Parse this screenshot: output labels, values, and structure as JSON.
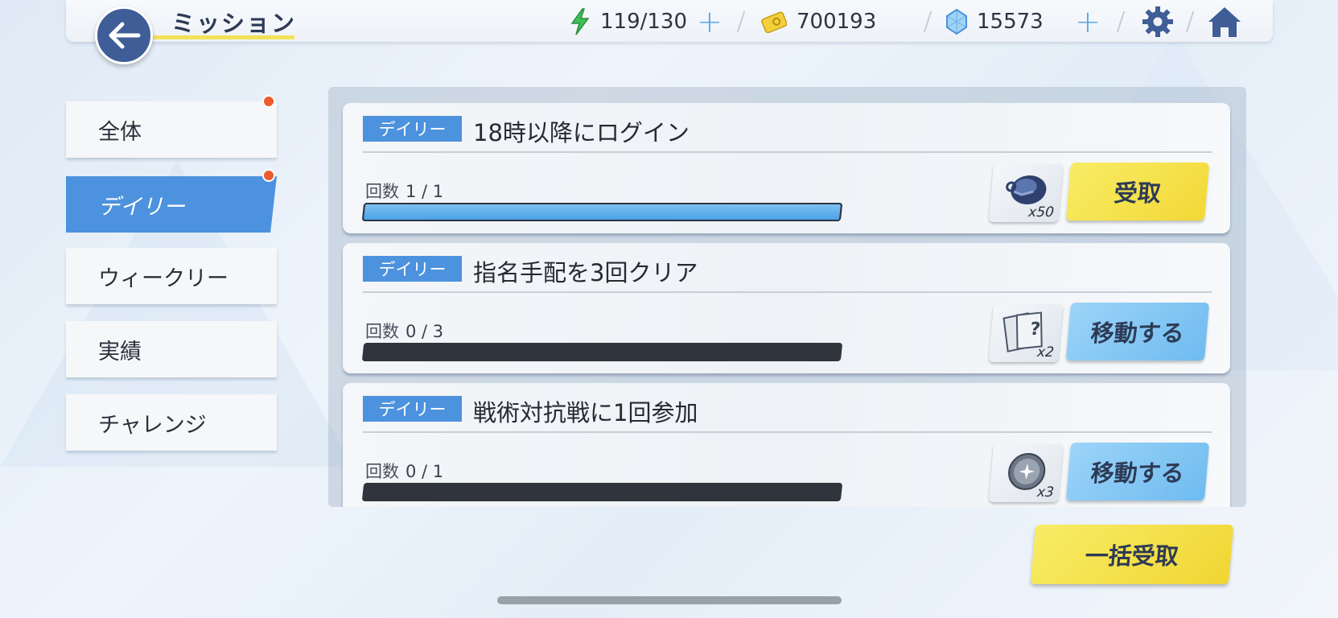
{
  "header": {
    "title": "ミッション",
    "stamina": "119/130",
    "coins": "700193",
    "gems": "15573"
  },
  "sidebar": {
    "items": [
      {
        "label": "全体",
        "active": false,
        "has_badge": true
      },
      {
        "label": "デイリー",
        "active": true,
        "has_badge": true
      },
      {
        "label": "ウィークリー",
        "active": false,
        "has_badge": false
      },
      {
        "label": "実績",
        "active": false,
        "has_badge": false
      },
      {
        "label": "チャレンジ",
        "active": false,
        "has_badge": false
      }
    ]
  },
  "missions": [
    {
      "tag": "デイリー",
      "title": "18時以降にログイン",
      "count_label": "回数",
      "count": "1 / 1",
      "progress": 1.0,
      "reward_qty": "x50",
      "reward_icon": "gear-parts-icon",
      "action": "受取",
      "action_style": "yellow"
    },
    {
      "tag": "デイリー",
      "title": "指名手配を3回クリア",
      "count_label": "回数",
      "count": "0 / 3",
      "progress": 0.0,
      "reward_qty": "x2",
      "reward_icon": "mystery-ticket-icon",
      "action": "移動する",
      "action_style": "blue"
    },
    {
      "tag": "デイリー",
      "title": "戦術対抗戦に1回参加",
      "count_label": "回数",
      "count": "0 / 1",
      "progress": 0.0,
      "reward_qty": "x3",
      "reward_icon": "silver-orb-icon",
      "action": "移動する",
      "action_style": "blue"
    }
  ],
  "footer": {
    "bulk_claim": "一括受取"
  },
  "colors": {
    "accent_blue": "#4c92de",
    "claim_yellow": "#f4de44",
    "move_blue": "#84c8f4",
    "badge_red": "#ec5a2d"
  }
}
